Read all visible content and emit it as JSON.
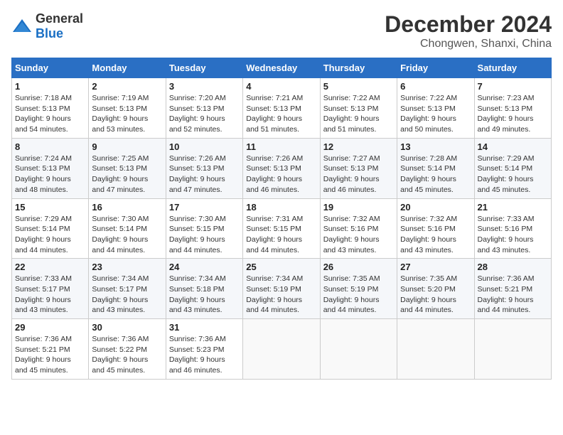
{
  "header": {
    "logo_general": "General",
    "logo_blue": "Blue",
    "month": "December 2024",
    "location": "Chongwen, Shanxi, China"
  },
  "weekdays": [
    "Sunday",
    "Monday",
    "Tuesday",
    "Wednesday",
    "Thursday",
    "Friday",
    "Saturday"
  ],
  "weeks": [
    [
      {
        "day": "1",
        "info": "Sunrise: 7:18 AM\nSunset: 5:13 PM\nDaylight: 9 hours\nand 54 minutes."
      },
      {
        "day": "2",
        "info": "Sunrise: 7:19 AM\nSunset: 5:13 PM\nDaylight: 9 hours\nand 53 minutes."
      },
      {
        "day": "3",
        "info": "Sunrise: 7:20 AM\nSunset: 5:13 PM\nDaylight: 9 hours\nand 52 minutes."
      },
      {
        "day": "4",
        "info": "Sunrise: 7:21 AM\nSunset: 5:13 PM\nDaylight: 9 hours\nand 51 minutes."
      },
      {
        "day": "5",
        "info": "Sunrise: 7:22 AM\nSunset: 5:13 PM\nDaylight: 9 hours\nand 51 minutes."
      },
      {
        "day": "6",
        "info": "Sunrise: 7:22 AM\nSunset: 5:13 PM\nDaylight: 9 hours\nand 50 minutes."
      },
      {
        "day": "7",
        "info": "Sunrise: 7:23 AM\nSunset: 5:13 PM\nDaylight: 9 hours\nand 49 minutes."
      }
    ],
    [
      {
        "day": "8",
        "info": "Sunrise: 7:24 AM\nSunset: 5:13 PM\nDaylight: 9 hours\nand 48 minutes."
      },
      {
        "day": "9",
        "info": "Sunrise: 7:25 AM\nSunset: 5:13 PM\nDaylight: 9 hours\nand 47 minutes."
      },
      {
        "day": "10",
        "info": "Sunrise: 7:26 AM\nSunset: 5:13 PM\nDaylight: 9 hours\nand 47 minutes."
      },
      {
        "day": "11",
        "info": "Sunrise: 7:26 AM\nSunset: 5:13 PM\nDaylight: 9 hours\nand 46 minutes."
      },
      {
        "day": "12",
        "info": "Sunrise: 7:27 AM\nSunset: 5:13 PM\nDaylight: 9 hours\nand 46 minutes."
      },
      {
        "day": "13",
        "info": "Sunrise: 7:28 AM\nSunset: 5:14 PM\nDaylight: 9 hours\nand 45 minutes."
      },
      {
        "day": "14",
        "info": "Sunrise: 7:29 AM\nSunset: 5:14 PM\nDaylight: 9 hours\nand 45 minutes."
      }
    ],
    [
      {
        "day": "15",
        "info": "Sunrise: 7:29 AM\nSunset: 5:14 PM\nDaylight: 9 hours\nand 44 minutes."
      },
      {
        "day": "16",
        "info": "Sunrise: 7:30 AM\nSunset: 5:14 PM\nDaylight: 9 hours\nand 44 minutes."
      },
      {
        "day": "17",
        "info": "Sunrise: 7:30 AM\nSunset: 5:15 PM\nDaylight: 9 hours\nand 44 minutes."
      },
      {
        "day": "18",
        "info": "Sunrise: 7:31 AM\nSunset: 5:15 PM\nDaylight: 9 hours\nand 44 minutes."
      },
      {
        "day": "19",
        "info": "Sunrise: 7:32 AM\nSunset: 5:16 PM\nDaylight: 9 hours\nand 43 minutes."
      },
      {
        "day": "20",
        "info": "Sunrise: 7:32 AM\nSunset: 5:16 PM\nDaylight: 9 hours\nand 43 minutes."
      },
      {
        "day": "21",
        "info": "Sunrise: 7:33 AM\nSunset: 5:16 PM\nDaylight: 9 hours\nand 43 minutes."
      }
    ],
    [
      {
        "day": "22",
        "info": "Sunrise: 7:33 AM\nSunset: 5:17 PM\nDaylight: 9 hours\nand 43 minutes."
      },
      {
        "day": "23",
        "info": "Sunrise: 7:34 AM\nSunset: 5:17 PM\nDaylight: 9 hours\nand 43 minutes."
      },
      {
        "day": "24",
        "info": "Sunrise: 7:34 AM\nSunset: 5:18 PM\nDaylight: 9 hours\nand 43 minutes."
      },
      {
        "day": "25",
        "info": "Sunrise: 7:34 AM\nSunset: 5:19 PM\nDaylight: 9 hours\nand 44 minutes."
      },
      {
        "day": "26",
        "info": "Sunrise: 7:35 AM\nSunset: 5:19 PM\nDaylight: 9 hours\nand 44 minutes."
      },
      {
        "day": "27",
        "info": "Sunrise: 7:35 AM\nSunset: 5:20 PM\nDaylight: 9 hours\nand 44 minutes."
      },
      {
        "day": "28",
        "info": "Sunrise: 7:36 AM\nSunset: 5:21 PM\nDaylight: 9 hours\nand 44 minutes."
      }
    ],
    [
      {
        "day": "29",
        "info": "Sunrise: 7:36 AM\nSunset: 5:21 PM\nDaylight: 9 hours\nand 45 minutes."
      },
      {
        "day": "30",
        "info": "Sunrise: 7:36 AM\nSunset: 5:22 PM\nDaylight: 9 hours\nand 45 minutes."
      },
      {
        "day": "31",
        "info": "Sunrise: 7:36 AM\nSunset: 5:23 PM\nDaylight: 9 hours\nand 46 minutes."
      },
      null,
      null,
      null,
      null
    ]
  ]
}
